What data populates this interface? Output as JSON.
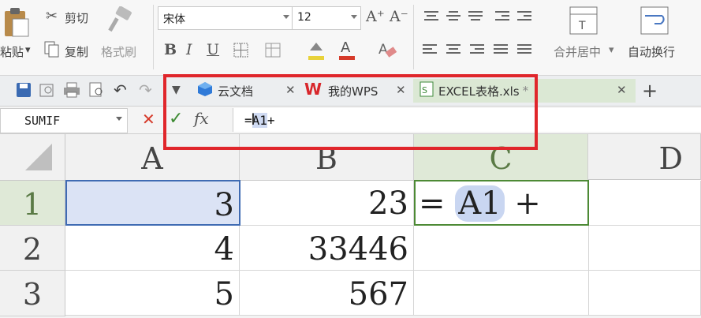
{
  "ribbon": {
    "paste_label": "粘贴",
    "cut_label": "剪切",
    "copy_label": "复制",
    "format_painter_label": "格式刷",
    "font_name": "宋体",
    "font_size": "12",
    "grow_font": "A⁺",
    "shrink_font": "A⁻",
    "bold": "B",
    "italic": "I",
    "underline": "U",
    "merge_center_label": "合并居中",
    "wrap_text_label": "自动换行"
  },
  "tabs": [
    {
      "label": "云文档"
    },
    {
      "label": "我的WPS"
    },
    {
      "label": "EXCEL表格.xls"
    }
  ],
  "new_tab": "+",
  "formula_bar": {
    "name_box": "SUMIF",
    "cancel": "✕",
    "enter": "✓",
    "fx": "fx",
    "formula_prefix": "=",
    "formula_ref": "A1",
    "formula_suffix": "+"
  },
  "sheet": {
    "columns": [
      "A",
      "B",
      "C",
      "D"
    ],
    "rows": [
      "1",
      "2",
      "3"
    ],
    "cells": {
      "A1": "3",
      "B1": "23",
      "C1_prefix": "= ",
      "C1_ref": "A1",
      "C1_suffix": " +",
      "A2": "4",
      "B2": "33446",
      "A3": "5",
      "B3": "567"
    }
  },
  "colors": {
    "highlight_border": "#e0262b",
    "active_header": "#dfe9d7",
    "selection": "#dbe3f5"
  }
}
